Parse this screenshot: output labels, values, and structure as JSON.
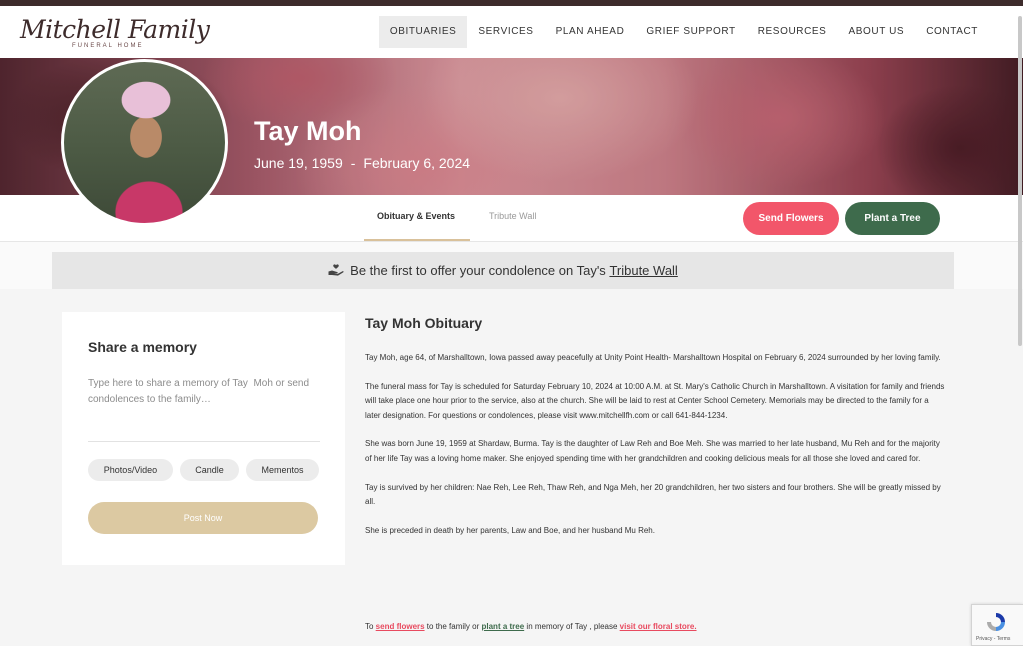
{
  "brand": {
    "name": "Mitchell Family",
    "subtitle": "FUNERAL HOME"
  },
  "nav": {
    "items": [
      {
        "label": "OBITUARIES",
        "active": true
      },
      {
        "label": "SERVICES"
      },
      {
        "label": "PLAN AHEAD"
      },
      {
        "label": "GRIEF SUPPORT"
      },
      {
        "label": "RESOURCES"
      },
      {
        "label": "ABOUT US"
      },
      {
        "label": "CONTACT"
      }
    ]
  },
  "hero": {
    "name": "Tay Moh",
    "birth_date": "June 19, 1959",
    "separator": "-",
    "death_date": "February 6, 2024"
  },
  "tabs": {
    "obituary": "Obituary & Events",
    "tribute": "Tribute Wall"
  },
  "actions": {
    "send_flowers": "Send Flowers",
    "plant_tree": "Plant a Tree"
  },
  "condolence_banner": {
    "text": "Be the first to offer your condolence on Tay's",
    "link": "Tribute Wall"
  },
  "memory": {
    "title": "Share a memory",
    "placeholder": "Type here to share a memory of Tay  Moh or send condolences to the family…",
    "chips": [
      "Photos/Video",
      "Candle",
      "Mementos"
    ],
    "post": "Post Now"
  },
  "obituary": {
    "title": "Tay Moh Obituary",
    "paragraphs": [
      "Tay Moh, age 64, of Marshalltown, Iowa passed away peacefully at Unity Point Health- Marshalltown Hospital on February 6, 2024 surrounded by her loving family.",
      "The funeral mass for Tay is scheduled for Saturday February 10, 2024 at 10:00 A.M. at St. Mary's Catholic Church in Marshalltown. A visitation for family and friends will take place one hour prior to the service, also at the church. She will be laid to rest at Center School Cemetery. Memorials may be directed to the family for a later designation. For questions or condolences, please visit www.mitchellfh.com or call 641-844-1234.",
      "She was born June 19, 1959 at Shardaw, Burma. Tay is the daughter of Law Reh and Boe Meh. She was married to her late husband, Mu Reh and for the majority of her life Tay was a loving home maker. She enjoyed spending time with her grandchildren and cooking delicious meals for all those she loved and cared for.",
      "Tay is survived by her children: Nae Reh, Lee Reh, Thaw Reh, and Nga Meh, her 20 grandchildren, her two sisters and four brothers. She will be greatly missed by all.",
      "She is preceded in death by her parents, Law and Boe, and her husband Mu Reh."
    ],
    "footer": {
      "t1": "To ",
      "l1": "send flowers",
      "t2": " to the family or ",
      "l2": "plant a tree",
      "t3": " in memory of Tay , please ",
      "l3": "visit our floral store."
    }
  },
  "recaptcha": {
    "label": "Privacy - Terms"
  },
  "colors": {
    "brand_dark": "#3d2b2b",
    "flowers_button": "#f2566a",
    "tree_button": "#3e6b4c",
    "post_button": "#dcc9a2",
    "tab_underline": "#d9c19b"
  },
  "icons": {
    "condolence": "hand-heart-icon",
    "recaptcha": "recaptcha-icon"
  }
}
